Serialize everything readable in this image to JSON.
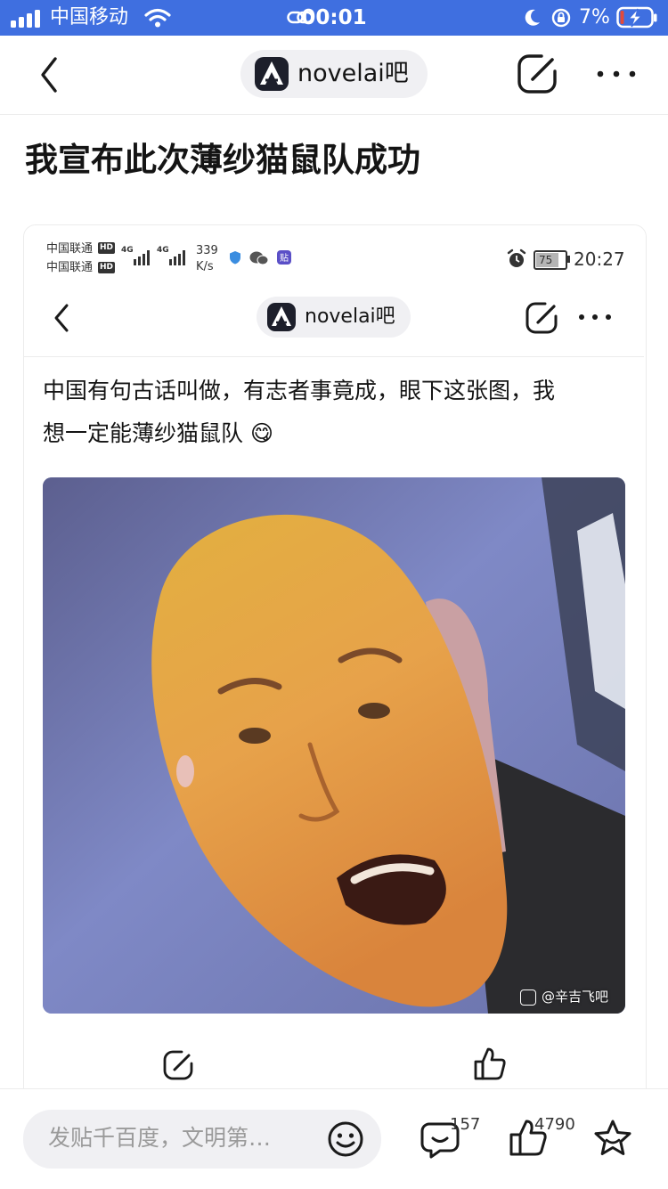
{
  "status_bar": {
    "carrier": "中国移动",
    "time": "00:01",
    "battery_percent": "7%",
    "signal_bars": 4
  },
  "nav": {
    "forum_name": "novelai吧",
    "icons": [
      "back-icon",
      "forum-logo-icon",
      "edit-icon",
      "more-icon"
    ]
  },
  "post": {
    "title": "我宣布此次薄纱猫鼠队成功"
  },
  "embedded": {
    "status": {
      "carrier_line1": "中国联通",
      "carrier_line2": "中国联通",
      "hd_badge": "HD",
      "net1": "4G",
      "net2": "4G",
      "speed_value": "339",
      "speed_unit": "K/s",
      "battery": "75",
      "time": "20:27"
    },
    "forum_name": "novelai吧",
    "body_line1": "中国有句古话叫做，有志者事竟成，眼下这张图，我",
    "body_line2": "想一定能薄纱猫鼠队",
    "emoji": "😋",
    "watermark": "@辛吉飞吧"
  },
  "bottom_bar": {
    "reply_placeholder": "发贴千百度，文明第…",
    "comment_count": "157",
    "like_count": "4790"
  },
  "colors": {
    "status_bar_bg": "#3f6fe0",
    "text_primary": "#141414",
    "pill_bg": "#f0f0f3",
    "icon_dark": "#1a1a1a"
  }
}
